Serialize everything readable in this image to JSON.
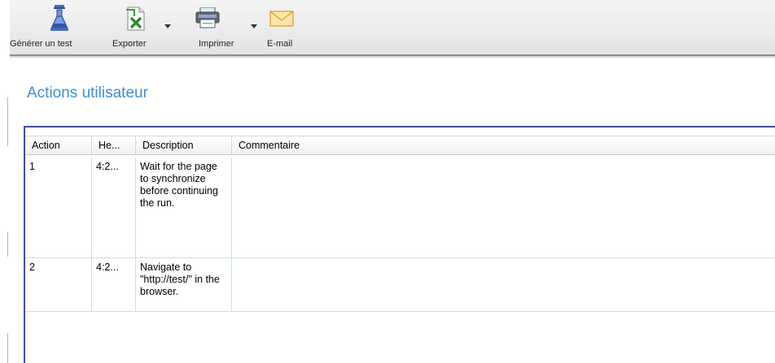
{
  "toolbar": {
    "buttons": [
      {
        "label": "Générer un test",
        "icon": "flask-icon"
      },
      {
        "label": "Exporter",
        "icon": "excel-export-icon"
      },
      {
        "label": "Imprimer",
        "icon": "printer-icon"
      },
      {
        "label": "E-mail",
        "icon": "envelope-icon"
      }
    ]
  },
  "page": {
    "title": "Actions utilisateur"
  },
  "grid": {
    "columns": [
      "Action",
      "He...",
      "Description",
      "Commentaire"
    ],
    "rows": [
      {
        "action": "1",
        "time": "4:2...",
        "description": "Wait for the page to synchronize before continuing the run.",
        "comment": ""
      },
      {
        "action": "2",
        "time": "4:2...",
        "description": "Navigate to \"http://test/\" in the browser.",
        "comment": ""
      }
    ]
  }
}
